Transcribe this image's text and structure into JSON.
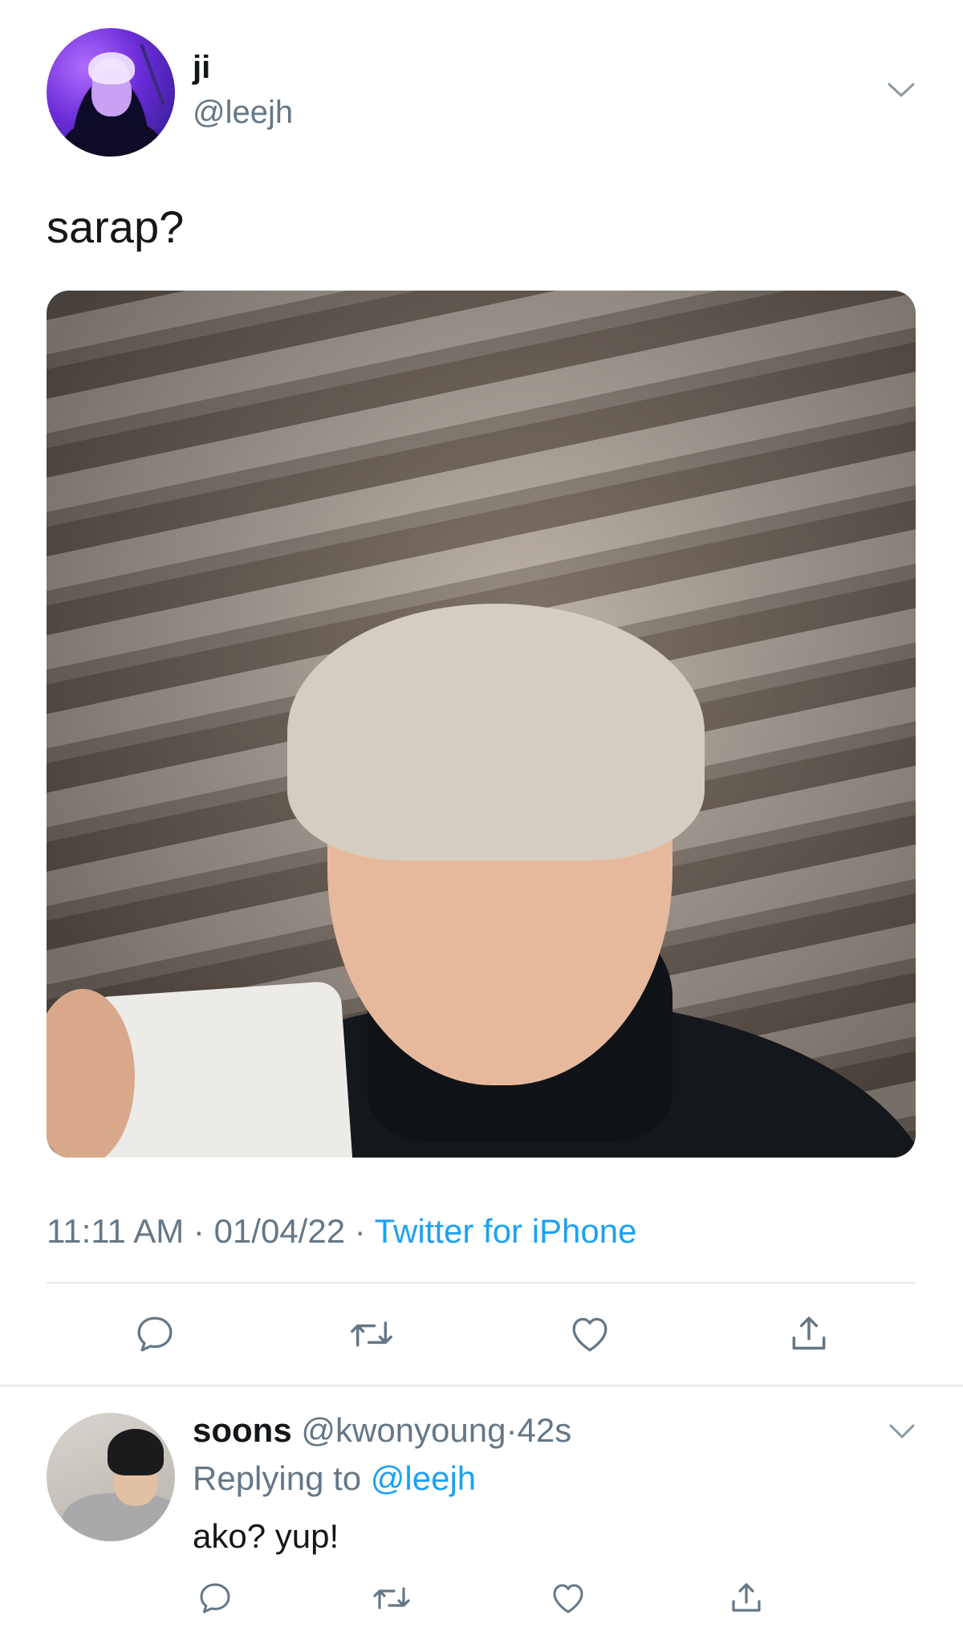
{
  "tweet": {
    "author_name": "ji",
    "author_handle": "@leejh",
    "text": "sarap?",
    "time": "11:11 AM",
    "separator": "·",
    "date": "01/04/22",
    "source": "Twitter for iPhone"
  },
  "reply": {
    "author_name": "soons",
    "author_handle": "@kwonyoung",
    "separator": "·",
    "age": "42s",
    "replying_label": "Replying to",
    "replying_mention": "@leejh",
    "text": "ako? yup!"
  },
  "icons": {
    "reply": "reply-icon",
    "retweet": "retweet-icon",
    "like": "like-icon",
    "share": "share-icon",
    "more": "chevron-down-icon"
  },
  "colors": {
    "text": "#14171a",
    "secondary": "#657786",
    "link": "#1da1f2",
    "divider": "#e1e8ed",
    "icon": "#657786"
  }
}
